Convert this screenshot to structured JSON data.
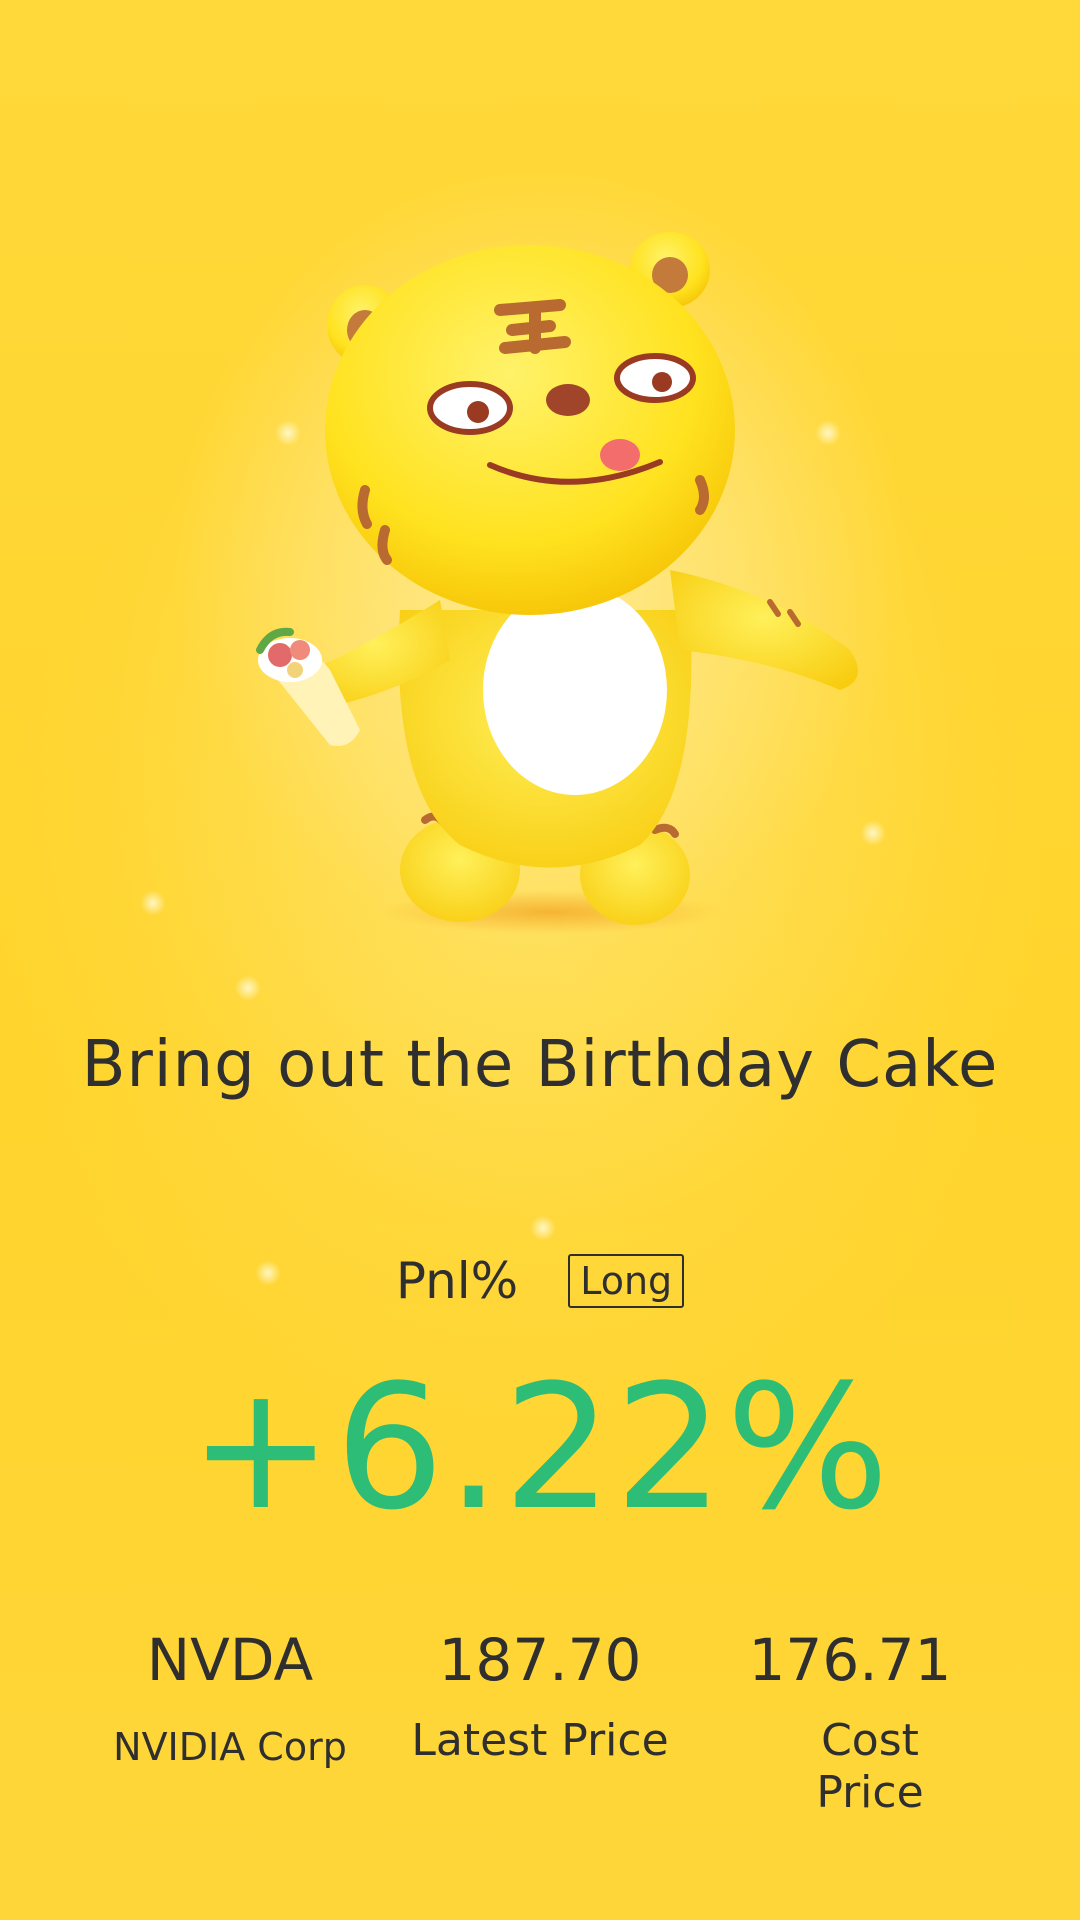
{
  "headline": "Bring out the Birthday Cake",
  "pnl": {
    "label": "Pnl%",
    "side_badge": "Long",
    "value": "+6.22%",
    "value_color": "#2dbd77"
  },
  "stats": {
    "ticker": "NVDA",
    "company": "NVIDIA Corp",
    "latest_price": "187.70",
    "latest_price_label": "Latest Price",
    "cost_price": "176.71",
    "cost_price_label": "Cost Price"
  },
  "colors": {
    "background": "#ffd42c",
    "text": "#2f2f2f",
    "positive": "#2dbd77"
  },
  "mascot": "tiger-mascot-holding-wrap"
}
